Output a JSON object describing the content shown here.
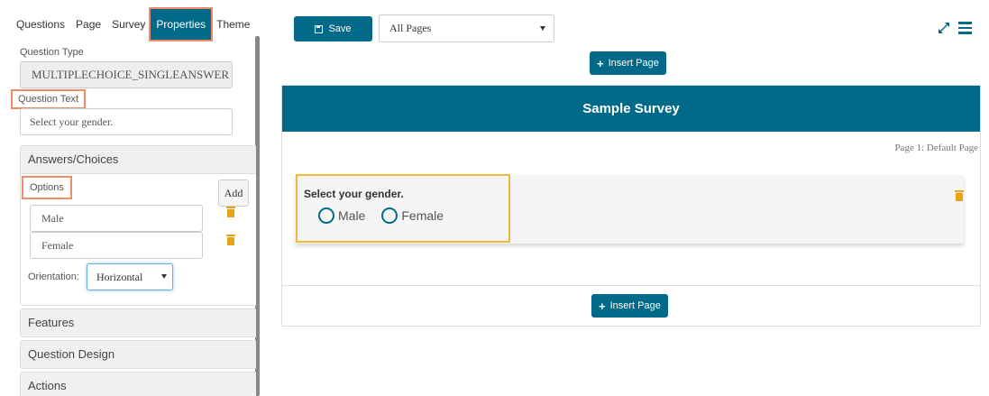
{
  "tabs": [
    "Questions",
    "Page",
    "Survey",
    "Properties",
    "Theme"
  ],
  "active_tab": "Properties",
  "properties": {
    "question_type_label": "Question Type",
    "question_type_value": "MULTIPLECHOICE_SINGLEANSWER",
    "question_text_label": "Question Text",
    "question_text_value": "Select your gender.",
    "answers_section": "Answers/Choices",
    "options_label": "Options",
    "add_label": "Add",
    "options": [
      "Male",
      "Female"
    ],
    "orientation_label": "Orientation:",
    "orientation_value": "Horizontal",
    "features_section": "Features",
    "question_design_section": "Question Design",
    "actions_section": "Actions"
  },
  "toolbar": {
    "save_label": "Save",
    "pages_select_value": "All Pages"
  },
  "survey": {
    "insert_page_label": "Insert Page",
    "title": "Sample Survey",
    "page_label": "Page 1:  Default Page",
    "question_text": "Select your gender.",
    "choices": [
      "Male",
      "Female"
    ]
  },
  "colors": {
    "brand": "#006a88",
    "highlight_orange": "#ef8b6a",
    "highlight_yellow": "#f0b93a",
    "trash": "#e8a317"
  },
  "icons": [
    "save-icon",
    "chevron-down-icon",
    "trash-icon",
    "expand-icon",
    "menu-icon",
    "plus-icon",
    "radio-icon"
  ]
}
